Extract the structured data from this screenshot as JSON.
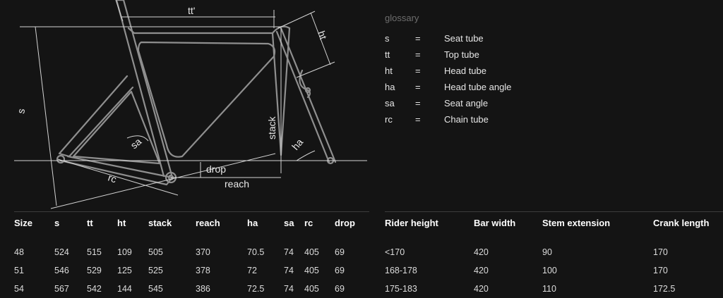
{
  "diagram": {
    "labels": {
      "tt": "tt'",
      "ht": "ht",
      "s": "s",
      "stack": "stack",
      "sa": "sa",
      "ha": "ha",
      "rc": "rc",
      "drop": "drop",
      "reach": "reach"
    }
  },
  "glossary": {
    "title": "glossary",
    "items": [
      {
        "key": "s",
        "eq": "=",
        "value": "Seat tube"
      },
      {
        "key": "tt",
        "eq": "=",
        "value": "Top tube"
      },
      {
        "key": "ht",
        "eq": "=",
        "value": "Head tube"
      },
      {
        "key": "ha",
        "eq": "=",
        "value": "Head tube angle"
      },
      {
        "key": "sa",
        "eq": "=",
        "value": "Seat angle"
      },
      {
        "key": "rc",
        "eq": "=",
        "value": "Chain tube"
      }
    ]
  },
  "size_table": {
    "headers": [
      "Size",
      "s",
      "tt",
      "ht",
      "stack",
      "reach",
      "ha",
      "sa",
      "rc",
      "drop"
    ],
    "rows": [
      [
        "48",
        "524",
        "515",
        "109",
        "505",
        "370",
        "70.5",
        "74",
        "405",
        "69"
      ],
      [
        "51",
        "546",
        "529",
        "125",
        "525",
        "378",
        "72",
        "74",
        "405",
        "69"
      ],
      [
        "54",
        "567",
        "542",
        "144",
        "545",
        "386",
        "72.5",
        "74",
        "405",
        "69"
      ]
    ]
  },
  "rider_table": {
    "headers": [
      "Rider height",
      "Bar width",
      "Stem extension",
      "Crank length"
    ],
    "rows": [
      [
        "<170",
        "420",
        "90",
        "170"
      ],
      [
        "168-178",
        "420",
        "100",
        "170"
      ],
      [
        "175-183",
        "420",
        "110",
        "172.5"
      ]
    ]
  }
}
